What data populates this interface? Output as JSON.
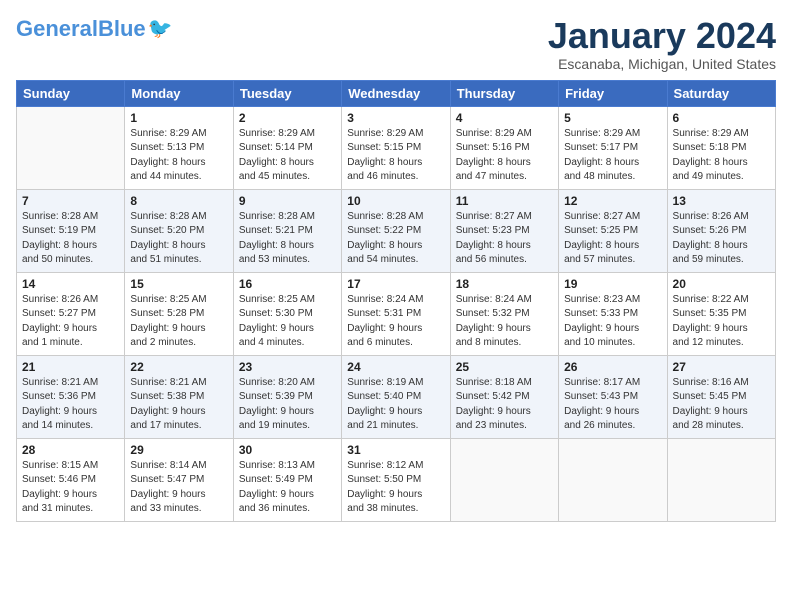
{
  "logo": {
    "text1": "General",
    "text2": "Blue"
  },
  "title": "January 2024",
  "location": "Escanaba, Michigan, United States",
  "days_of_week": [
    "Sunday",
    "Monday",
    "Tuesday",
    "Wednesday",
    "Thursday",
    "Friday",
    "Saturday"
  ],
  "weeks": [
    [
      {
        "day": "",
        "info": ""
      },
      {
        "day": "1",
        "info": "Sunrise: 8:29 AM\nSunset: 5:13 PM\nDaylight: 8 hours\nand 44 minutes."
      },
      {
        "day": "2",
        "info": "Sunrise: 8:29 AM\nSunset: 5:14 PM\nDaylight: 8 hours\nand 45 minutes."
      },
      {
        "day": "3",
        "info": "Sunrise: 8:29 AM\nSunset: 5:15 PM\nDaylight: 8 hours\nand 46 minutes."
      },
      {
        "day": "4",
        "info": "Sunrise: 8:29 AM\nSunset: 5:16 PM\nDaylight: 8 hours\nand 47 minutes."
      },
      {
        "day": "5",
        "info": "Sunrise: 8:29 AM\nSunset: 5:17 PM\nDaylight: 8 hours\nand 48 minutes."
      },
      {
        "day": "6",
        "info": "Sunrise: 8:29 AM\nSunset: 5:18 PM\nDaylight: 8 hours\nand 49 minutes."
      }
    ],
    [
      {
        "day": "7",
        "info": "Sunrise: 8:28 AM\nSunset: 5:19 PM\nDaylight: 8 hours\nand 50 minutes."
      },
      {
        "day": "8",
        "info": "Sunrise: 8:28 AM\nSunset: 5:20 PM\nDaylight: 8 hours\nand 51 minutes."
      },
      {
        "day": "9",
        "info": "Sunrise: 8:28 AM\nSunset: 5:21 PM\nDaylight: 8 hours\nand 53 minutes."
      },
      {
        "day": "10",
        "info": "Sunrise: 8:28 AM\nSunset: 5:22 PM\nDaylight: 8 hours\nand 54 minutes."
      },
      {
        "day": "11",
        "info": "Sunrise: 8:27 AM\nSunset: 5:23 PM\nDaylight: 8 hours\nand 56 minutes."
      },
      {
        "day": "12",
        "info": "Sunrise: 8:27 AM\nSunset: 5:25 PM\nDaylight: 8 hours\nand 57 minutes."
      },
      {
        "day": "13",
        "info": "Sunrise: 8:26 AM\nSunset: 5:26 PM\nDaylight: 8 hours\nand 59 minutes."
      }
    ],
    [
      {
        "day": "14",
        "info": "Sunrise: 8:26 AM\nSunset: 5:27 PM\nDaylight: 9 hours\nand 1 minute."
      },
      {
        "day": "15",
        "info": "Sunrise: 8:25 AM\nSunset: 5:28 PM\nDaylight: 9 hours\nand 2 minutes."
      },
      {
        "day": "16",
        "info": "Sunrise: 8:25 AM\nSunset: 5:30 PM\nDaylight: 9 hours\nand 4 minutes."
      },
      {
        "day": "17",
        "info": "Sunrise: 8:24 AM\nSunset: 5:31 PM\nDaylight: 9 hours\nand 6 minutes."
      },
      {
        "day": "18",
        "info": "Sunrise: 8:24 AM\nSunset: 5:32 PM\nDaylight: 9 hours\nand 8 minutes."
      },
      {
        "day": "19",
        "info": "Sunrise: 8:23 AM\nSunset: 5:33 PM\nDaylight: 9 hours\nand 10 minutes."
      },
      {
        "day": "20",
        "info": "Sunrise: 8:22 AM\nSunset: 5:35 PM\nDaylight: 9 hours\nand 12 minutes."
      }
    ],
    [
      {
        "day": "21",
        "info": "Sunrise: 8:21 AM\nSunset: 5:36 PM\nDaylight: 9 hours\nand 14 minutes."
      },
      {
        "day": "22",
        "info": "Sunrise: 8:21 AM\nSunset: 5:38 PM\nDaylight: 9 hours\nand 17 minutes."
      },
      {
        "day": "23",
        "info": "Sunrise: 8:20 AM\nSunset: 5:39 PM\nDaylight: 9 hours\nand 19 minutes."
      },
      {
        "day": "24",
        "info": "Sunrise: 8:19 AM\nSunset: 5:40 PM\nDaylight: 9 hours\nand 21 minutes."
      },
      {
        "day": "25",
        "info": "Sunrise: 8:18 AM\nSunset: 5:42 PM\nDaylight: 9 hours\nand 23 minutes."
      },
      {
        "day": "26",
        "info": "Sunrise: 8:17 AM\nSunset: 5:43 PM\nDaylight: 9 hours\nand 26 minutes."
      },
      {
        "day": "27",
        "info": "Sunrise: 8:16 AM\nSunset: 5:45 PM\nDaylight: 9 hours\nand 28 minutes."
      }
    ],
    [
      {
        "day": "28",
        "info": "Sunrise: 8:15 AM\nSunset: 5:46 PM\nDaylight: 9 hours\nand 31 minutes."
      },
      {
        "day": "29",
        "info": "Sunrise: 8:14 AM\nSunset: 5:47 PM\nDaylight: 9 hours\nand 33 minutes."
      },
      {
        "day": "30",
        "info": "Sunrise: 8:13 AM\nSunset: 5:49 PM\nDaylight: 9 hours\nand 36 minutes."
      },
      {
        "day": "31",
        "info": "Sunrise: 8:12 AM\nSunset: 5:50 PM\nDaylight: 9 hours\nand 38 minutes."
      },
      {
        "day": "",
        "info": ""
      },
      {
        "day": "",
        "info": ""
      },
      {
        "day": "",
        "info": ""
      }
    ]
  ]
}
